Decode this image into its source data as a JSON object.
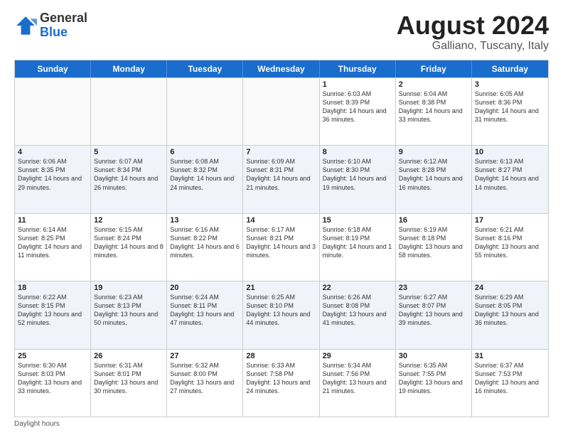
{
  "header": {
    "logo_general": "General",
    "logo_blue": "Blue",
    "main_title": "August 2024",
    "sub_title": "Galliano, Tuscany, Italy"
  },
  "calendar": {
    "days_of_week": [
      "Sunday",
      "Monday",
      "Tuesday",
      "Wednesday",
      "Thursday",
      "Friday",
      "Saturday"
    ],
    "weeks": [
      {
        "row_alt": false,
        "cells": [
          {
            "day": "",
            "info": "",
            "empty": true
          },
          {
            "day": "",
            "info": "",
            "empty": true
          },
          {
            "day": "",
            "info": "",
            "empty": true
          },
          {
            "day": "",
            "info": "",
            "empty": true
          },
          {
            "day": "1",
            "info": "Sunrise: 6:03 AM\nSunset: 8:39 PM\nDaylight: 14 hours\nand 36 minutes.",
            "empty": false
          },
          {
            "day": "2",
            "info": "Sunrise: 6:04 AM\nSunset: 8:38 PM\nDaylight: 14 hours\nand 33 minutes.",
            "empty": false
          },
          {
            "day": "3",
            "info": "Sunrise: 6:05 AM\nSunset: 8:36 PM\nDaylight: 14 hours\nand 31 minutes.",
            "empty": false
          }
        ]
      },
      {
        "row_alt": true,
        "cells": [
          {
            "day": "4",
            "info": "Sunrise: 6:06 AM\nSunset: 8:35 PM\nDaylight: 14 hours\nand 29 minutes.",
            "empty": false
          },
          {
            "day": "5",
            "info": "Sunrise: 6:07 AM\nSunset: 8:34 PM\nDaylight: 14 hours\nand 26 minutes.",
            "empty": false
          },
          {
            "day": "6",
            "info": "Sunrise: 6:08 AM\nSunset: 8:32 PM\nDaylight: 14 hours\nand 24 minutes.",
            "empty": false
          },
          {
            "day": "7",
            "info": "Sunrise: 6:09 AM\nSunset: 8:31 PM\nDaylight: 14 hours\nand 21 minutes.",
            "empty": false
          },
          {
            "day": "8",
            "info": "Sunrise: 6:10 AM\nSunset: 8:30 PM\nDaylight: 14 hours\nand 19 minutes.",
            "empty": false
          },
          {
            "day": "9",
            "info": "Sunrise: 6:12 AM\nSunset: 8:28 PM\nDaylight: 14 hours\nand 16 minutes.",
            "empty": false
          },
          {
            "day": "10",
            "info": "Sunrise: 6:13 AM\nSunset: 8:27 PM\nDaylight: 14 hours\nand 14 minutes.",
            "empty": false
          }
        ]
      },
      {
        "row_alt": false,
        "cells": [
          {
            "day": "11",
            "info": "Sunrise: 6:14 AM\nSunset: 8:25 PM\nDaylight: 14 hours\nand 11 minutes.",
            "empty": false
          },
          {
            "day": "12",
            "info": "Sunrise: 6:15 AM\nSunset: 8:24 PM\nDaylight: 14 hours\nand 8 minutes.",
            "empty": false
          },
          {
            "day": "13",
            "info": "Sunrise: 6:16 AM\nSunset: 8:22 PM\nDaylight: 14 hours\nand 6 minutes.",
            "empty": false
          },
          {
            "day": "14",
            "info": "Sunrise: 6:17 AM\nSunset: 8:21 PM\nDaylight: 14 hours\nand 3 minutes.",
            "empty": false
          },
          {
            "day": "15",
            "info": "Sunrise: 6:18 AM\nSunset: 8:19 PM\nDaylight: 14 hours\nand 1 minute.",
            "empty": false
          },
          {
            "day": "16",
            "info": "Sunrise: 6:19 AM\nSunset: 8:18 PM\nDaylight: 13 hours\nand 58 minutes.",
            "empty": false
          },
          {
            "day": "17",
            "info": "Sunrise: 6:21 AM\nSunset: 8:16 PM\nDaylight: 13 hours\nand 55 minutes.",
            "empty": false
          }
        ]
      },
      {
        "row_alt": true,
        "cells": [
          {
            "day": "18",
            "info": "Sunrise: 6:22 AM\nSunset: 8:15 PM\nDaylight: 13 hours\nand 52 minutes.",
            "empty": false
          },
          {
            "day": "19",
            "info": "Sunrise: 6:23 AM\nSunset: 8:13 PM\nDaylight: 13 hours\nand 50 minutes.",
            "empty": false
          },
          {
            "day": "20",
            "info": "Sunrise: 6:24 AM\nSunset: 8:11 PM\nDaylight: 13 hours\nand 47 minutes.",
            "empty": false
          },
          {
            "day": "21",
            "info": "Sunrise: 6:25 AM\nSunset: 8:10 PM\nDaylight: 13 hours\nand 44 minutes.",
            "empty": false
          },
          {
            "day": "22",
            "info": "Sunrise: 6:26 AM\nSunset: 8:08 PM\nDaylight: 13 hours\nand 41 minutes.",
            "empty": false
          },
          {
            "day": "23",
            "info": "Sunrise: 6:27 AM\nSunset: 8:07 PM\nDaylight: 13 hours\nand 39 minutes.",
            "empty": false
          },
          {
            "day": "24",
            "info": "Sunrise: 6:29 AM\nSunset: 8:05 PM\nDaylight: 13 hours\nand 36 minutes.",
            "empty": false
          }
        ]
      },
      {
        "row_alt": false,
        "cells": [
          {
            "day": "25",
            "info": "Sunrise: 6:30 AM\nSunset: 8:03 PM\nDaylight: 13 hours\nand 33 minutes.",
            "empty": false
          },
          {
            "day": "26",
            "info": "Sunrise: 6:31 AM\nSunset: 8:01 PM\nDaylight: 13 hours\nand 30 minutes.",
            "empty": false
          },
          {
            "day": "27",
            "info": "Sunrise: 6:32 AM\nSunset: 8:00 PM\nDaylight: 13 hours\nand 27 minutes.",
            "empty": false
          },
          {
            "day": "28",
            "info": "Sunrise: 6:33 AM\nSunset: 7:58 PM\nDaylight: 13 hours\nand 24 minutes.",
            "empty": false
          },
          {
            "day": "29",
            "info": "Sunrise: 6:34 AM\nSunset: 7:56 PM\nDaylight: 13 hours\nand 21 minutes.",
            "empty": false
          },
          {
            "day": "30",
            "info": "Sunrise: 6:35 AM\nSunset: 7:55 PM\nDaylight: 13 hours\nand 19 minutes.",
            "empty": false
          },
          {
            "day": "31",
            "info": "Sunrise: 6:37 AM\nSunset: 7:53 PM\nDaylight: 13 hours\nand 16 minutes.",
            "empty": false
          }
        ]
      }
    ]
  },
  "footer": {
    "note": "Daylight hours"
  }
}
